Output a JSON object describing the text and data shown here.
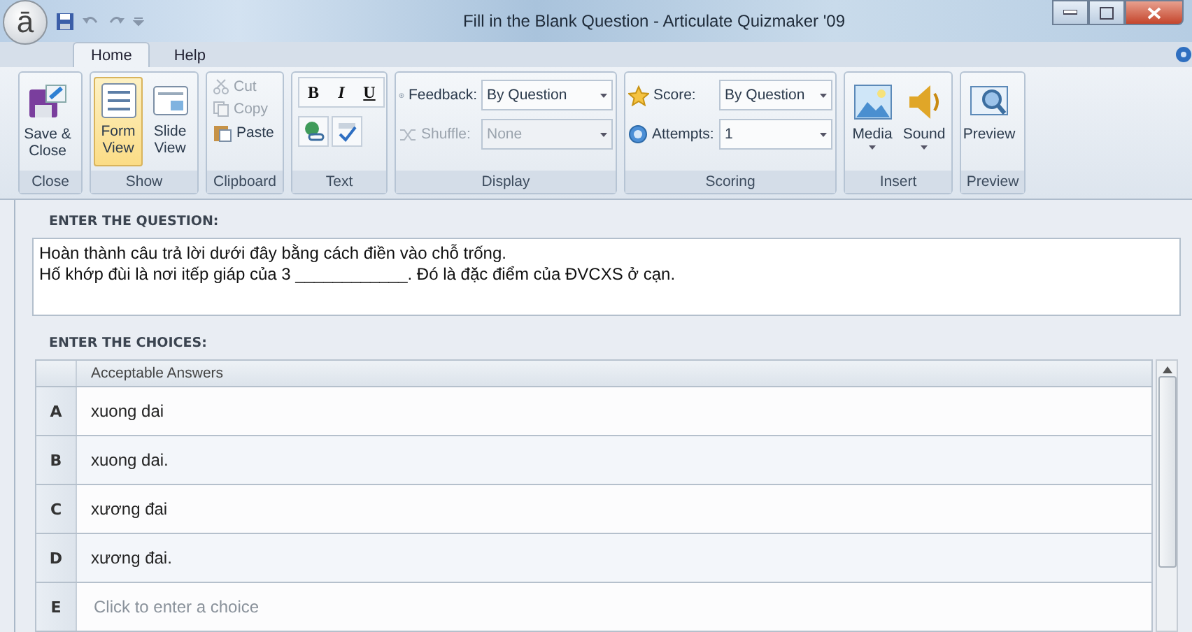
{
  "window": {
    "logo": "ā",
    "title": "Fill in the Blank Question - Articulate Quizmaker '09"
  },
  "tabs": [
    {
      "label": "Home",
      "selected": true
    },
    {
      "label": "Help",
      "selected": false
    }
  ],
  "ribbon": [
    {
      "label": "Close",
      "items": [
        {
          "kind": "large",
          "label": "Save & Close",
          "selected": false,
          "menu": false
        }
      ]
    },
    {
      "label": "Show",
      "items": [
        {
          "kind": "large",
          "label": "Form View",
          "selected": true,
          "menu": false
        },
        {
          "kind": "large",
          "label": "Slide View",
          "selected": false,
          "menu": false
        }
      ]
    },
    {
      "label": "Clipboard",
      "items": [
        {
          "kind": "small",
          "label": "Cut",
          "disabled": true
        },
        {
          "kind": "small",
          "label": "Copy",
          "disabled": true
        },
        {
          "kind": "small",
          "label": "Paste",
          "disabled": false
        }
      ]
    },
    {
      "label": "Text",
      "items": [
        {
          "kind": "format",
          "label": "B"
        },
        {
          "kind": "format",
          "label": "I"
        },
        {
          "kind": "format",
          "label": "U"
        },
        {
          "kind": "tool"
        },
        {
          "kind": "tool"
        }
      ]
    },
    {
      "label": "Display",
      "items": [
        {
          "kind": "combo",
          "label": "Feedback:",
          "value": "By Question",
          "disabled": false
        },
        {
          "kind": "combo",
          "label": "Shuffle:",
          "value": "None",
          "disabled": true
        }
      ]
    },
    {
      "label": "Scoring",
      "items": [
        {
          "kind": "combo",
          "label": "Score:",
          "value": "By Question",
          "disabled": false
        },
        {
          "kind": "combo",
          "label": "Attempts:",
          "value": "1",
          "disabled": false
        }
      ]
    },
    {
      "label": "Insert",
      "items": [
        {
          "kind": "large",
          "label": "Media",
          "selected": false,
          "menu": true
        },
        {
          "kind": "large",
          "label": "Sound",
          "selected": false,
          "menu": true
        }
      ]
    },
    {
      "label": "Preview",
      "items": [
        {
          "kind": "large",
          "label": "Preview",
          "selected": false,
          "menu": false
        }
      ]
    }
  ],
  "question": {
    "heading": "ENTER THE QUESTION:",
    "lines": [
      "Hoàn thành câu trả lời dưới đây bằng cách điền vào chỗ trống.",
      "Hố khớp đùi là nơi itếp giáp của 3 ____________. Đó là đặc điểm của ĐVCXS ở cạn."
    ]
  },
  "choices": {
    "heading": "ENTER THE CHOICES:",
    "column": "Acceptable Answers",
    "rows": [
      {
        "letter": "A",
        "text": "xuong dai"
      },
      {
        "letter": "B",
        "text": "xuong dai."
      },
      {
        "letter": "C",
        "text": "xương đai"
      },
      {
        "letter": "D",
        "text": "xương đai."
      },
      {
        "letter": "E",
        "placeholder": "Click to enter a choice"
      }
    ]
  }
}
